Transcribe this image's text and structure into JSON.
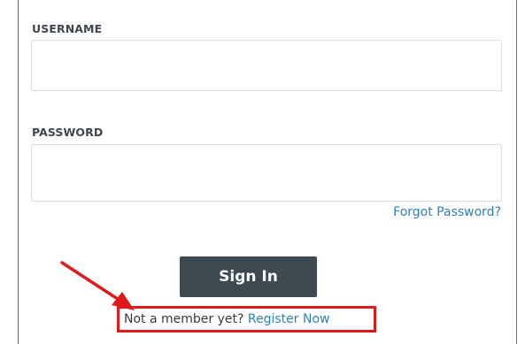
{
  "form": {
    "username_label": "USERNAME",
    "username_value": "",
    "password_label": "PASSWORD",
    "password_value": "",
    "forgot_password_label": "Forgot Password?",
    "sign_in_label": "Sign In",
    "not_member_text": "Not a member yet? ",
    "register_label": "Register Now"
  },
  "colors": {
    "button_bg": "#3e4a52",
    "link": "#2d82b5",
    "highlight": "#e0191b"
  }
}
